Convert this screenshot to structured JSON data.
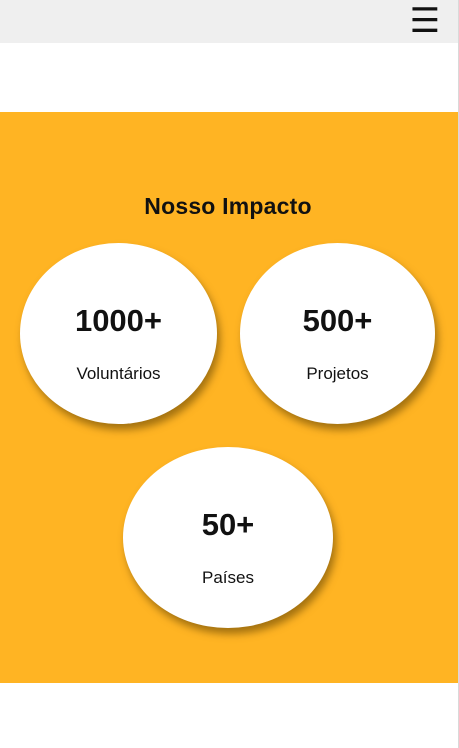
{
  "header": {
    "menu_icon": "☰"
  },
  "impact": {
    "title": "Nosso Impacto",
    "stats": [
      {
        "value": "1000+",
        "label": "Voluntários"
      },
      {
        "value": "500+",
        "label": "Projetos"
      },
      {
        "value": "50+",
        "label": "Países"
      }
    ]
  },
  "colors": {
    "topbar": "#efefef",
    "accent": "#ffb423",
    "card": "#ffffff",
    "text": "#111111"
  }
}
